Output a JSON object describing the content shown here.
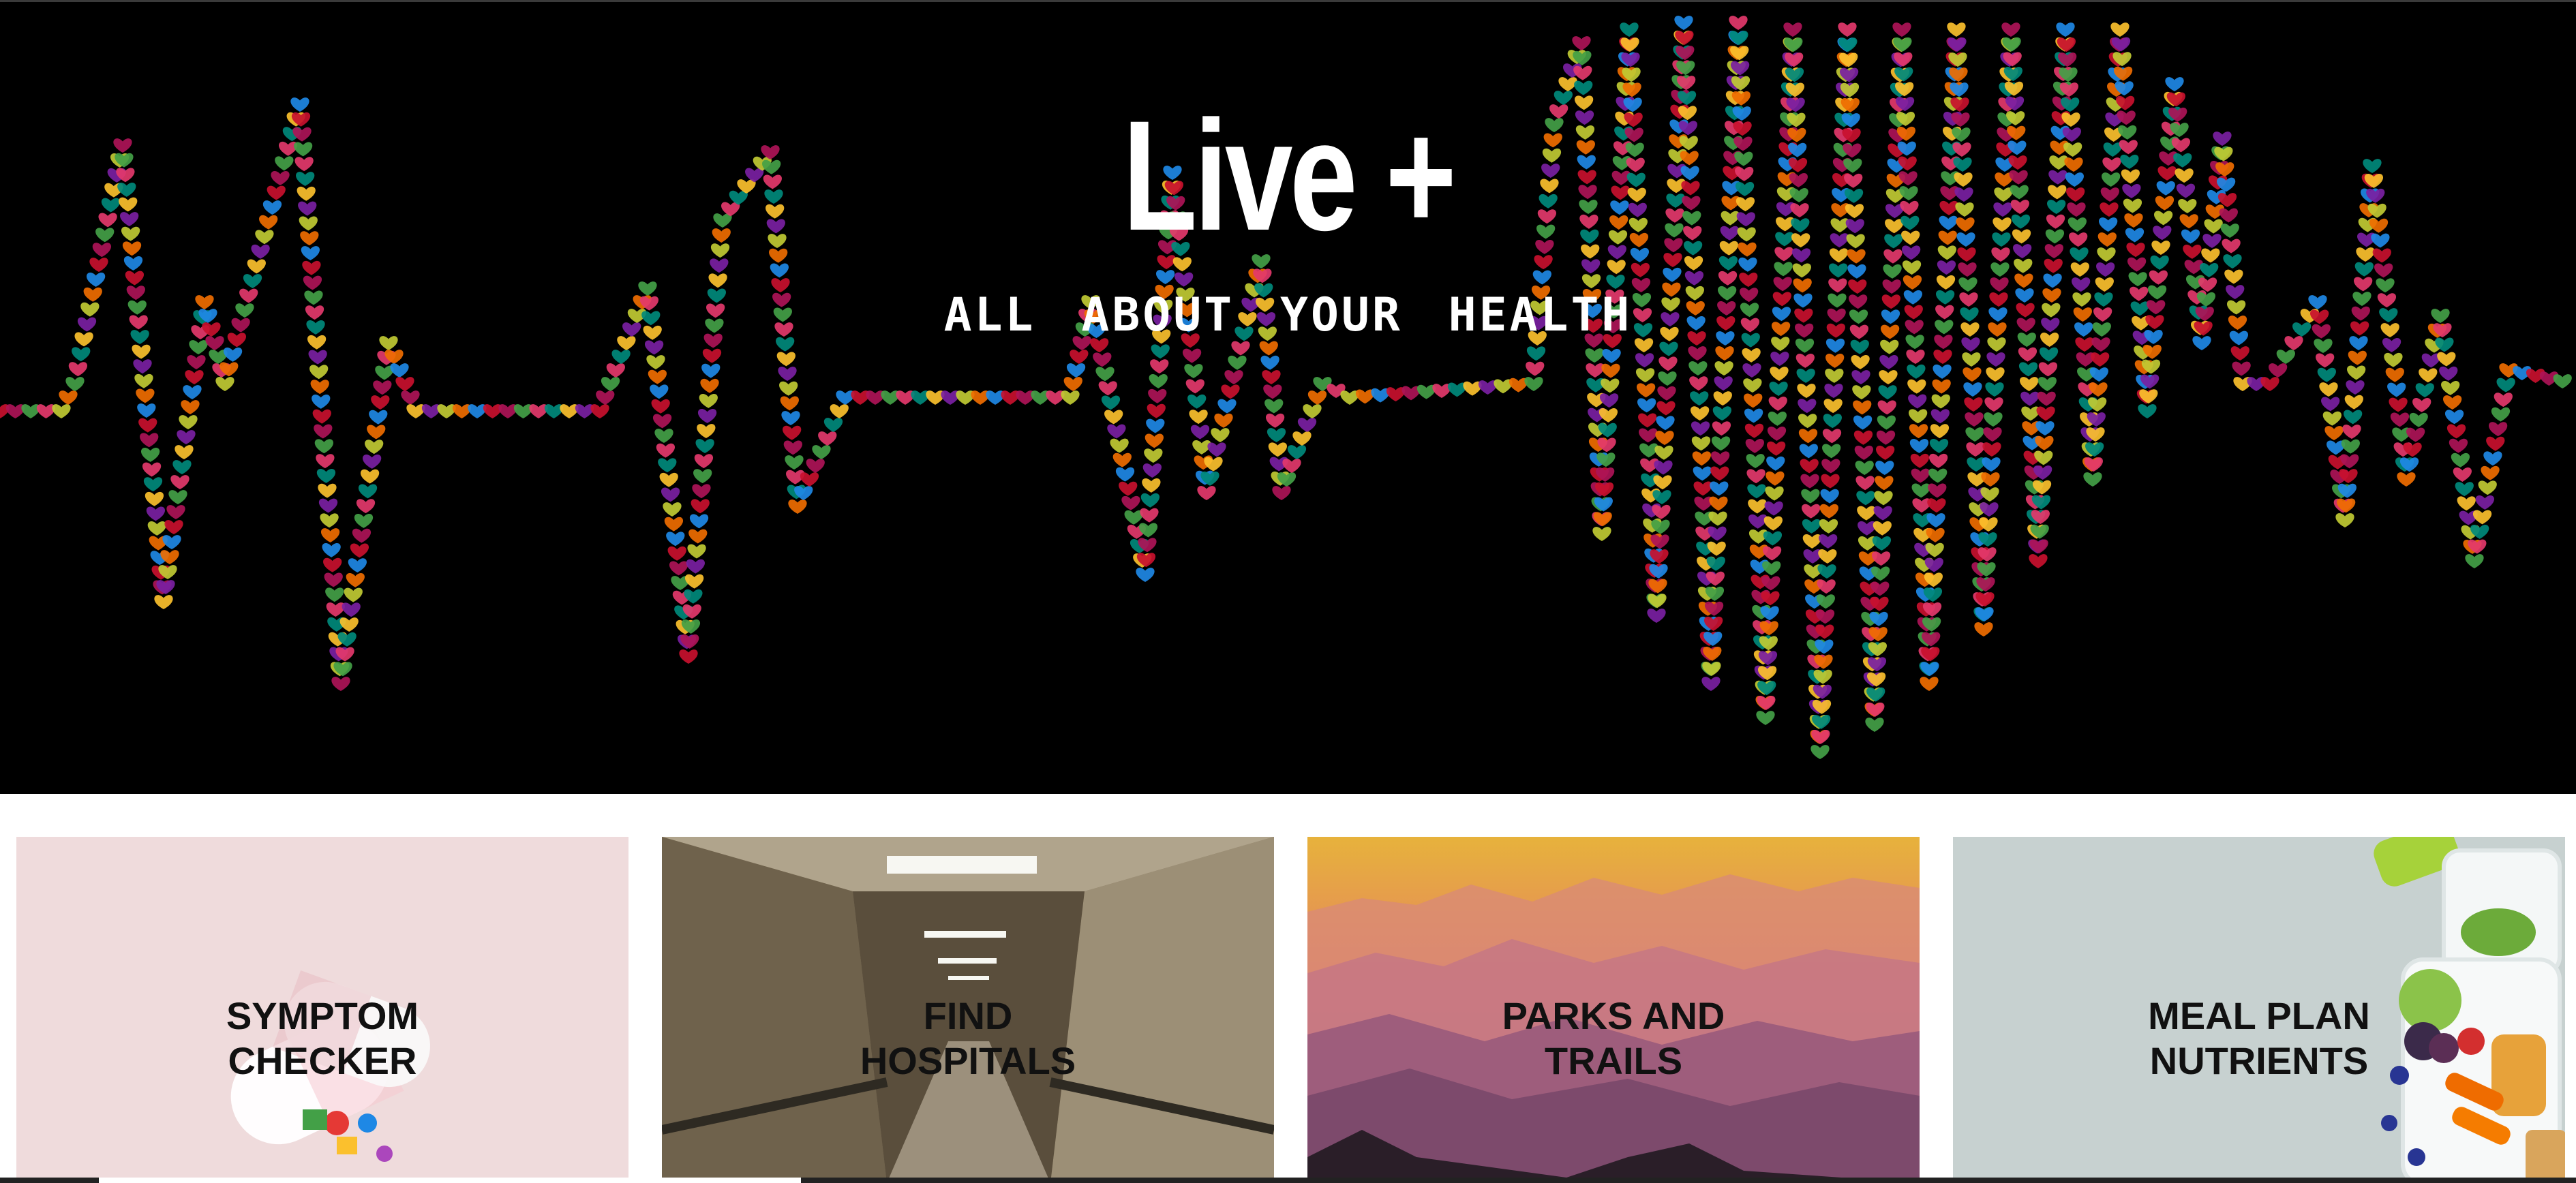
{
  "hero": {
    "title": "Live +",
    "subtitle": "ALL ABOUT YOUR HEALTH",
    "background_color": "#000000"
  },
  "cards": [
    {
      "line1": "SYMPTOM",
      "line2": "CHECKER",
      "icon": "pills-icon"
    },
    {
      "line1": "FIND",
      "line2": "HOSPITALS",
      "icon": "hospital-corridor-icon"
    },
    {
      "line1": "PARKS AND",
      "line2": "TRAILS",
      "icon": "mountains-icon"
    },
    {
      "line1": "MEAL PLAN",
      "line2": "NUTRIENTS",
      "icon": "meal-box-icon"
    }
  ],
  "colors": {
    "card1_bg": "#ecd6d8",
    "card2_bg": "#8a7b62",
    "card3_sky_top": "#e7b23c",
    "card3_sky_bottom": "#b56a86",
    "card4_bg": "#c7d1d0",
    "heart_palette": [
      "#c8102e",
      "#e3386b",
      "#7a1fa2",
      "#1e88e5",
      "#43a047",
      "#fbc02d",
      "#ef6c00",
      "#ad1457",
      "#00897b",
      "#c0ca33"
    ]
  }
}
